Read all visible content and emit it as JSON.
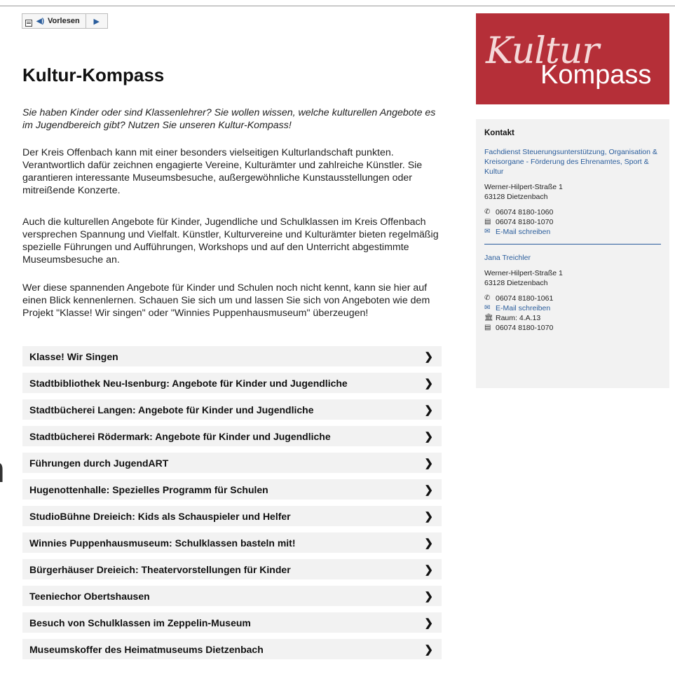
{
  "readspeaker": {
    "label": "Vorlesen"
  },
  "title": "Kultur-Kompass",
  "intro": "Sie haben Kinder oder sind Klassenlehrer? Sie wollen wissen, welche kulturellen Angebote es im Jugendbereich gibt? Nutzen Sie unseren Kultur-Kompass!",
  "paragraphs": [
    "Der Kreis Offenbach kann mit einer besonders vielseitigen Kulturlandschaft punkten. Verantwortlich dafür zeichnen engagierte Vereine, Kulturämter und zahlreiche Künstler. Sie garantieren interessante Museumsbesuche, außergewöhnliche Kunstausstellungen oder mitreißende Konzerte.",
    "Auch die kulturellen Angebote für Kinder, Jugendliche und Schulklassen im Kreis Offenbach versprechen Spannung und Vielfalt. Künstler, Kulturvereine und Kulturämter bieten regelmäßig spezielle Führungen und Aufführungen, Workshops und auf den Unterricht abgestimmte Museumsbesuche an.",
    "Wer diese spannenden Angebote für Kinder und Schulen noch nicht kennt, kann sie hier auf einen Blick kennenlernen. Schauen Sie sich um und lassen Sie sich von Angeboten wie dem Projekt \"Klasse! Wir singen\" oder \"Winnies Puppenhausmuseum\" überzeugen!"
  ],
  "accordion": [
    "Klasse! Wir Singen",
    "Stadtbibliothek Neu-Isenburg: Angebote für Kinder und Jugendliche",
    "Stadtbücherei Langen: Angebote für Kinder und Jugendliche",
    "Stadtbücherei Rödermark: Angebote für Kinder und Jugendliche",
    "Führungen durch JugendART",
    "Hugenottenhalle: Spezielles Programm für Schulen",
    "StudioBühne Dreieich: Kids als Schauspieler und Helfer",
    "Winnies Puppenhausmuseum: Schulklassen basteln mit!",
    "Bürgerhäuser Dreieich: Theatervorstellungen für Kinder",
    "Teeniechor Obertshausen",
    "Besuch von Schulklassen im Zeppelin-Museum",
    "Museumskoffer des Heimatmuseums Dietzenbach"
  ],
  "overflow_glyph": "n",
  "logo": {
    "line1": "Kultur",
    "line2": "Kompass"
  },
  "contact": {
    "heading": "Kontakt",
    "department": "Fachdienst Steuerungsunterstützung, Organisation & Kreisorgane - Förderung des Ehrenamtes, Sport & Kultur",
    "address1": "Werner-Hilpert-Straße 1",
    "city1": "63128 Dietzenbach",
    "phone1": "06074 8180-1060",
    "fax1": "06074 8180-1070",
    "email1": "E-Mail schreiben",
    "person": "Jana Treichler",
    "address2": "Werner-Hilpert-Straße 1",
    "city2": "63128 Dietzenbach",
    "phone2": "06074 8180-1061",
    "email2": "E-Mail schreiben",
    "room": "Raum: 4.A.13",
    "fax2": "06074 8180-1070"
  },
  "colors": {
    "accent": "#2a5d9c",
    "logo_bg": "#b52f38",
    "panel_bg": "#f2f2f2"
  }
}
